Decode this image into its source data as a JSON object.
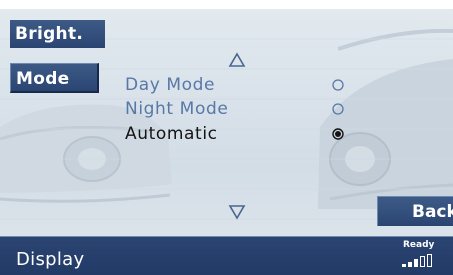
{
  "side_buttons": {
    "bright_label": "Bright.",
    "mode_label": "Mode"
  },
  "menu": {
    "scroll_up_icon": "up-triangle-icon",
    "scroll_down_icon": "down-triangle-icon",
    "items": [
      {
        "label": "Day Mode",
        "selected": false
      },
      {
        "label": "Night Mode",
        "selected": false
      },
      {
        "label": "Automatic",
        "selected": true
      }
    ]
  },
  "back_button": {
    "label": "Back"
  },
  "status_bar": {
    "title": "Display",
    "status_text": "Ready",
    "signal_icon": "signal-strength-icon"
  },
  "colors": {
    "button_bg": "#2f4a78",
    "status_bar_bg": "#263f6c",
    "inactive_text": "#5878a6",
    "active_text": "#141414",
    "screen_bg": "#dae2ea"
  }
}
